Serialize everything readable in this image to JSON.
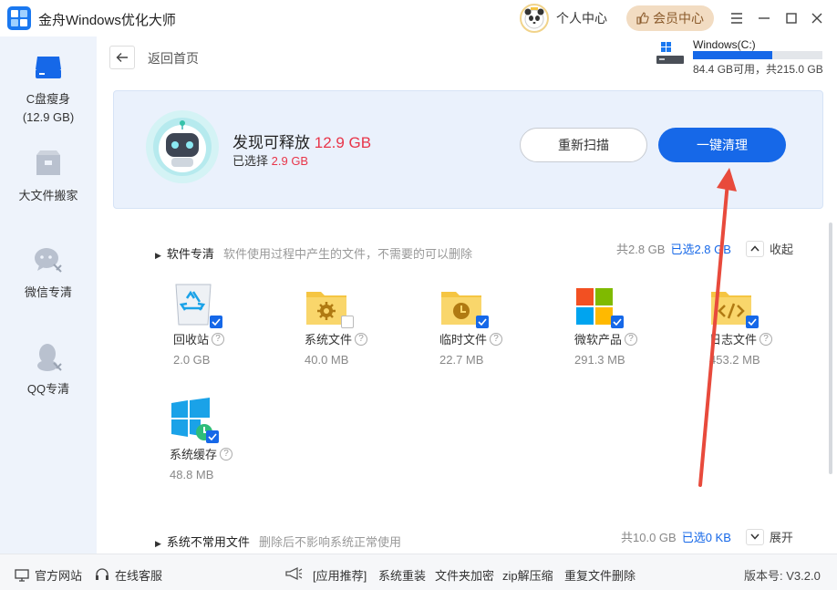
{
  "app": {
    "title": "金舟Windows优化大师"
  },
  "header": {
    "profile_label": "个人中心",
    "vip_label": "会员中心"
  },
  "sidebar": {
    "items": [
      {
        "label": "C盘瘦身",
        "sub": "(12.9 GB)"
      },
      {
        "label": "大文件搬家"
      },
      {
        "label": "微信专清"
      },
      {
        "label": "QQ专清"
      }
    ]
  },
  "nav": {
    "back_label": "返回首页"
  },
  "drive": {
    "name": "Windows(C:)",
    "info": "84.4 GB可用，共215.0 GB",
    "used_fraction": 0.61
  },
  "summary": {
    "found_prefix": "发现可释放",
    "found_amount": "12.9 GB",
    "selected_prefix": "已选择",
    "selected_amount": "2.9 GB",
    "rescan_label": "重新扫描",
    "clean_label": "一键清理"
  },
  "sections": [
    {
      "title": "软件专清",
      "desc": "软件使用过程中产生的文件，不需要的可以删除",
      "total": "共2.8 GB",
      "selected": "已选2.8 GB",
      "toggle": "收起",
      "items": [
        {
          "name": "回收站",
          "size": "2.0 GB"
        },
        {
          "name": "系统文件",
          "size": "40.0 MB"
        },
        {
          "name": "临时文件",
          "size": "22.7 MB"
        },
        {
          "name": "微软产品",
          "size": "291.3 MB"
        },
        {
          "name": "日志文件",
          "size": "453.2 MB"
        },
        {
          "name": "系统缓存",
          "size": "48.8 MB"
        }
      ]
    },
    {
      "title": "系统不常用文件",
      "desc": "删除后不影响系统正常使用",
      "total": "共10.0 GB",
      "selected": "已选0 KB",
      "toggle": "展开"
    }
  ],
  "footer": {
    "website": "官方网站",
    "support": "在线客服",
    "app_recommend": "[应用推荐]",
    "reinstall": "系统重装",
    "encrypt": "文件夹加密",
    "zip": "zip解压缩",
    "dedupe": "重复文件删除",
    "version": "版本号: V3.2.0"
  },
  "colors": {
    "accent": "#1668e8",
    "highlight": "#e8354a",
    "annotation_arrow": "#e84a3c"
  }
}
